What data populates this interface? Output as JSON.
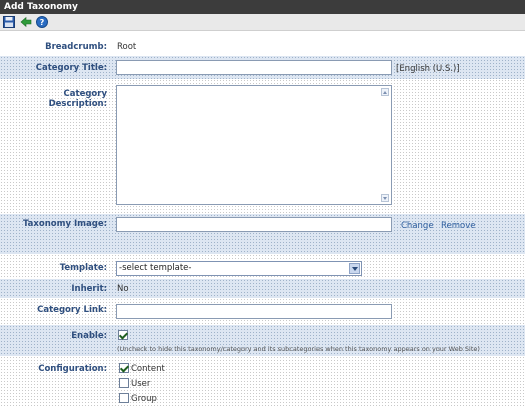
{
  "window": {
    "title": "Add Taxonomy"
  },
  "toolbar": {
    "save_icon": "save-icon",
    "back_icon": "back-arrow-icon",
    "help_icon": "help-icon"
  },
  "form": {
    "breadcrumb": {
      "label": "Breadcrumb:",
      "value": "Root"
    },
    "category_title": {
      "label": "Category Title:",
      "value": "",
      "language": "[English (U.S.)]"
    },
    "category_description": {
      "label": "Category Description:",
      "value": ""
    },
    "taxonomy_image": {
      "label": "Taxonomy Image:",
      "value": "",
      "change": "Change",
      "remove": "Remove"
    },
    "template": {
      "label": "Template:",
      "selected": "-select template-"
    },
    "inherit": {
      "label": "Inherit:",
      "value": "No"
    },
    "category_link": {
      "label": "Category Link:",
      "value": ""
    },
    "enable": {
      "label": "Enable:",
      "checked": true,
      "note": "(Uncheck to hide this taxonomy/category and its subcategories when this taxonomy appears on your Web Site)"
    },
    "configuration": {
      "label": "Configuration:",
      "options": [
        {
          "label": "Content",
          "checked": true
        },
        {
          "label": "User",
          "checked": false
        },
        {
          "label": "Group",
          "checked": false
        }
      ]
    }
  },
  "colors": {
    "accent": "#2f4f7f",
    "titlebar": "#3c3c3c",
    "link": "#2f5f9f"
  }
}
